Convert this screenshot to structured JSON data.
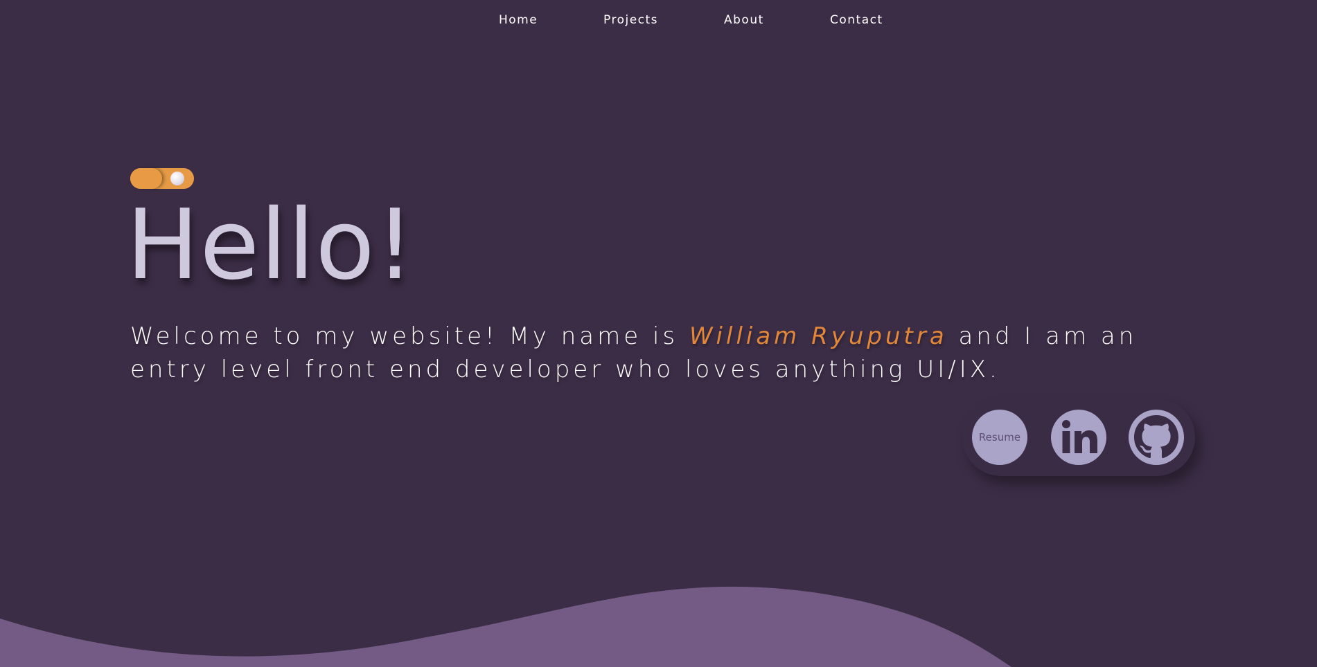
{
  "nav": {
    "items": [
      {
        "label": "Home"
      },
      {
        "label": "Projects"
      },
      {
        "label": "About"
      },
      {
        "label": "Contact"
      }
    ]
  },
  "theme_toggle": {
    "icon": "moon-icon",
    "state": "on"
  },
  "hero": {
    "title": "Hello!",
    "intro_before": "Welcome to my website! My name is ",
    "name": "William Ryuputra",
    "intro_after": " and I am an entry level front end developer who loves anything UI/IX."
  },
  "social": {
    "resume_label": "Resume",
    "icons": [
      "linkedin-icon",
      "github-icon"
    ]
  },
  "colors": {
    "background": "#3c2d46",
    "accent": "#e2863a",
    "toggle": "#e69a45",
    "heading": "#cfc9de",
    "social_button": "#aaa4c8",
    "wave": "#745b85"
  }
}
